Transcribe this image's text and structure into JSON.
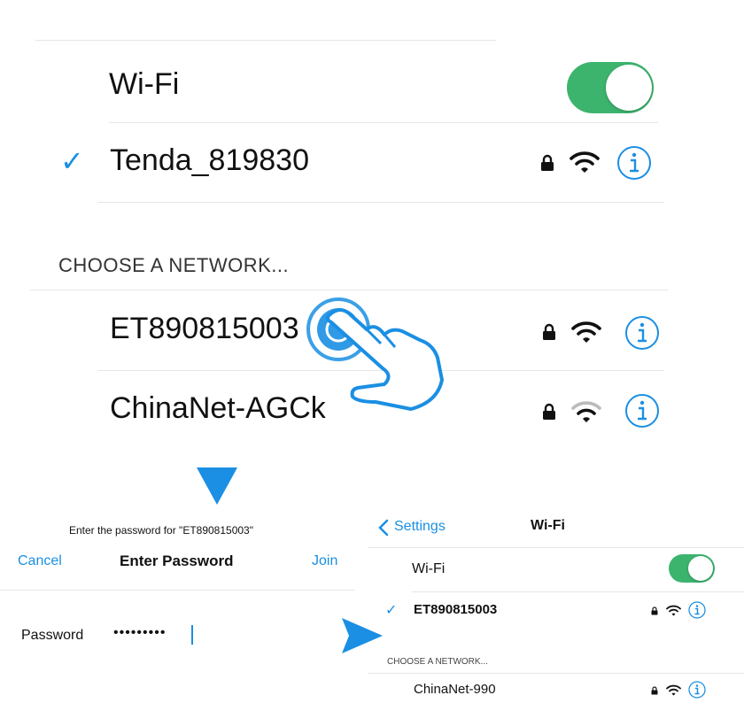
{
  "top_panel": {
    "wifi_label": "Wi-Fi",
    "wifi_toggle_on": true,
    "connected_network": {
      "check": "✓",
      "name": "Tenda_819830"
    },
    "section_header": "CHOOSE A NETWORK...",
    "networks": [
      {
        "name": "ET890815003"
      },
      {
        "name": "ChinaNet-AGCk"
      }
    ]
  },
  "password_dialog": {
    "prompt": "Enter the password for \"ET890815003\"",
    "cancel_label": "Cancel",
    "title": "Enter Password",
    "join_label": "Join",
    "password_label": "Password",
    "password_value": "•••••••••"
  },
  "result_panel": {
    "back_label": "Settings",
    "nav_title": "Wi-Fi",
    "wifi_label": "Wi-Fi",
    "wifi_toggle_on": true,
    "connected_network": {
      "check": "✓",
      "name": "ET890815003"
    },
    "section_header": "CHOOSE A NETWORK...",
    "networks": [
      {
        "name": "ChinaNet-990"
      }
    ]
  },
  "colors": {
    "accent": "#1a8fe3",
    "toggle_green": "#3cb46e",
    "pointer_blue": "#1a8fe3"
  },
  "icons": [
    "lock-icon",
    "wifi-icon",
    "info-icon",
    "checkmark-icon",
    "tap-hand-icon",
    "arrow-down-icon",
    "arrow-right-icon",
    "back-chevron-icon"
  ]
}
